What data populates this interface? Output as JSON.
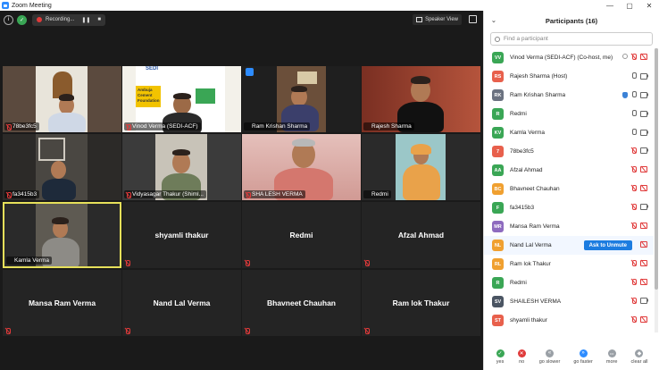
{
  "window": {
    "title": "Zoom Meeting",
    "controls": [
      "—",
      "▢",
      "✕"
    ]
  },
  "toolbar": {
    "recording_label": "Recording...",
    "pause_glyph": "❚❚",
    "stop_glyph": "■",
    "speaker_view_label": "Speaker View"
  },
  "tiles": [
    {
      "label": "78be3fc5"
    },
    {
      "label": "Vinod Verma (SEDI-ACF)"
    },
    {
      "label": "Ram Krishan Sharma"
    },
    {
      "label": "Rajesh Sharma"
    },
    {
      "label": "fa3415b3"
    },
    {
      "label": "Vidyasagar Thakur (Shiml..."
    },
    {
      "label": "SHA LESH VERMA"
    },
    {
      "label": "Redmi"
    },
    {
      "label": "Kamla Verma"
    },
    {
      "label": "shyamli thakur"
    },
    {
      "label": "Redmi"
    },
    {
      "label": "Afzal Ahmad"
    },
    {
      "label": "Mansa Ram Verma"
    },
    {
      "label": "Nand Lal Verma"
    },
    {
      "label": "Bhavneet Chauhan"
    },
    {
      "label": "Ram lok Thakur"
    }
  ],
  "banner": {
    "line1": "Ambuja",
    "line2": "Cement",
    "line3": "Foundation",
    "logo": "SEDI"
  },
  "participants_panel": {
    "title": "Participants (16)",
    "search_placeholder": "Find a participant",
    "unmute_label": "Ask to Unmute",
    "items": [
      {
        "initials": "VV",
        "name": "Vinod Verma (SEDI-ACF) (Co-host, me)",
        "color": "#3aa655"
      },
      {
        "initials": "RS",
        "name": "Rajesh Sharma (Host)",
        "color": "#e8604c"
      },
      {
        "initials": "RK",
        "name": "Ram Krishan Sharma",
        "color": "#6b7280"
      },
      {
        "initials": "R",
        "name": "Redmi",
        "color": "#3aa655"
      },
      {
        "initials": "KV",
        "name": "Kamla Verma",
        "color": "#3aa655"
      },
      {
        "initials": "7",
        "name": "78be3fc5",
        "color": "#e8604c"
      },
      {
        "initials": "AA",
        "name": "Afzal Ahmad",
        "color": "#3aa655"
      },
      {
        "initials": "BC",
        "name": "Bhavneet Chauhan",
        "color": "#f0a030"
      },
      {
        "initials": "F",
        "name": "fa3415b3",
        "color": "#3aa655"
      },
      {
        "initials": "MR",
        "name": "Mansa Ram Verma",
        "color": "#8e6bbf"
      },
      {
        "initials": "NL",
        "name": "Nand Lal Verma",
        "color": "#f0a030"
      },
      {
        "initials": "RL",
        "name": "Ram lok Thakur",
        "color": "#f0a030"
      },
      {
        "initials": "R",
        "name": "Redmi",
        "color": "#e8604c"
      },
      {
        "initials": "SV",
        "name": "SHAILESH VERMA",
        "color": "#4b5563"
      },
      {
        "initials": "ST",
        "name": "shyamli thakur",
        "color": "#e8604c"
      }
    ],
    "footer": [
      {
        "label": "yes",
        "glyph": "✓",
        "color": "#3aa655"
      },
      {
        "label": "no",
        "glyph": "✕",
        "color": "#e03a3a"
      },
      {
        "label": "go slower",
        "glyph": "«",
        "color": "#9aa0a6"
      },
      {
        "label": "go faster",
        "glyph": "»",
        "color": "#2d8cff"
      },
      {
        "label": "more",
        "glyph": "•••",
        "color": "#9aa0a6"
      },
      {
        "label": "clear all",
        "glyph": "◆",
        "color": "#9aa0a6"
      }
    ]
  },
  "colors": {
    "accent": "#2d8cff",
    "muted": "#e03a3a",
    "active_border": "#e6e05a"
  }
}
